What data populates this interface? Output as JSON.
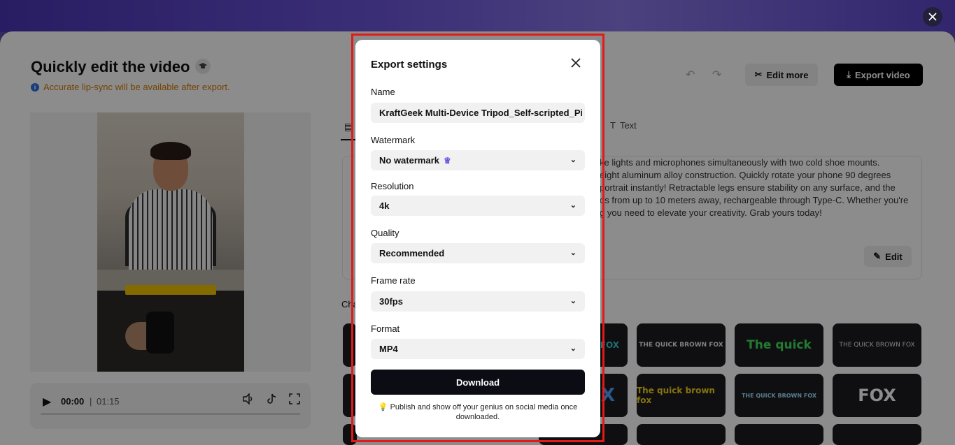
{
  "window": {
    "close_icon": "close-icon"
  },
  "header": {
    "title": "Quickly edit the video",
    "notice": "Accurate lip-sync will be available after export.",
    "edit_more": "Edit more",
    "export_video": "Export video"
  },
  "player": {
    "current_time": "00:00",
    "separator": "|",
    "duration": "01:15",
    "progress": 0
  },
  "tabs": {
    "text_tab": "Text"
  },
  "script": {
    "lines": [
      "ke lights and microphones simultaneously with two cold shoe mounts.",
      "eight aluminum alloy construction. Quickly rotate your phone 90 degrees",
      "portrait instantly! Retractable legs ensure stability on any surface, and the",
      "os from up to 10 meters away, rechargeable through Type-C. Whether you're",
      "g you need to elevate your creativity. Grab yours today!"
    ],
    "edit_label": "Edit"
  },
  "caption_section": {
    "label": "Cha"
  },
  "caption_tiles": [
    {
      "text": "FOX",
      "color": "#36c9d6"
    },
    {
      "text": "THE QUICK BROWN FOX",
      "color": "#e6e6e6"
    },
    {
      "text": "The quick",
      "color": "#3fe05a"
    },
    {
      "text": "THE QUICK BROWN FOX",
      "color": "#e6e6e6"
    },
    {
      "text": "X",
      "color": "#4aa0ff"
    },
    {
      "text": "The quick brown fox",
      "color": "#f5d21a"
    },
    {
      "text": "THE QUICK BROWN FOX",
      "color": "#9fe0ff"
    },
    {
      "text": "FOX",
      "color": "#ffffff"
    }
  ],
  "modal": {
    "title": "Export settings",
    "name_label": "Name",
    "name_value": "KraftGeek Multi-Device Tripod_Self-scripted_Pip",
    "watermark_label": "Watermark",
    "watermark_value": "No watermark",
    "resolution_label": "Resolution",
    "resolution_value": "4k",
    "quality_label": "Quality",
    "quality_value": "Recommended",
    "framerate_label": "Frame rate",
    "framerate_value": "30fps",
    "format_label": "Format",
    "format_value": "MP4",
    "download_label": "Download",
    "tip": "Publish and show off your genius on social media once downloaded."
  },
  "colors": {
    "accent_purple": "#5b4fe0",
    "highlight_red": "#e11a1a",
    "notice_orange": "#d27a00",
    "primary_button": "#0c0c14"
  }
}
